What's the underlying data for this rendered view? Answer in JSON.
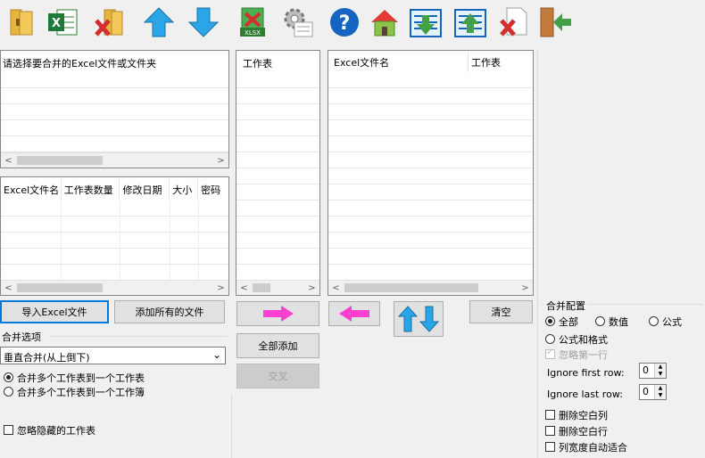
{
  "toolbar": [
    "open-folder-icon",
    "excel-file-icon",
    "delete-folder-icon",
    "move-up-icon",
    "move-down-icon",
    "export-xlsx-icon",
    "settings-icon",
    "help-icon",
    "home-icon",
    "import-list-icon",
    "export-list-icon",
    "delete-file-icon",
    "exit-icon"
  ],
  "source": {
    "title": "请选择要合并的Excel文件或文件夹"
  },
  "files": {
    "cols": [
      "Excel文件名",
      "工作表数量",
      "修改日期",
      "大小",
      "密码"
    ]
  },
  "sheets": {
    "col": "工作表"
  },
  "merged": {
    "cols": [
      "Excel文件名",
      "工作表"
    ]
  },
  "buttons": {
    "import": "导入Excel文件",
    "add_all_files": "添加所有的文件",
    "add_all": "全部添加",
    "swap": "交叉",
    "clear": "清空"
  },
  "options": {
    "title": "合并选项",
    "mode": "垂直合并(从上倒下)",
    "r1": "合并多个工作表到一个工作表",
    "r2": "合并多个工作表到一个工作簿",
    "ignore_hidden": "忽略隐藏的工作表"
  },
  "config": {
    "title": "合并配置",
    "all": "全部",
    "values": "数值",
    "formula": "公式",
    "formula_fmt": "公式和格式",
    "ignore_first": "忽略第一行",
    "first_row_label": "Ignore first row:",
    "first_row": "0",
    "last_row_label": "Ignore last row:",
    "last_row": "0",
    "del_empty_cols": "删除空白列",
    "del_empty_rows": "删除空白行",
    "autofit": "列宽度自动适合"
  }
}
